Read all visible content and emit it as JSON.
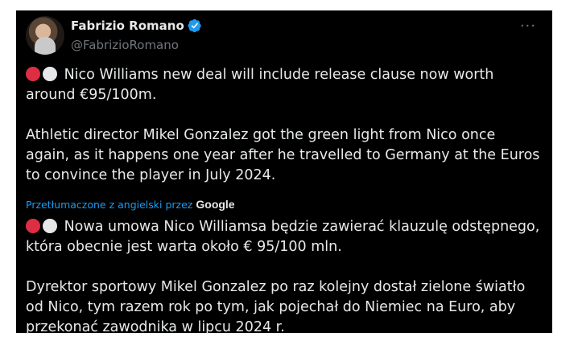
{
  "author": {
    "display_name": "Fabrizio Romano",
    "handle": "@FabrizioRomano",
    "verified_icon": "verified-badge-icon",
    "more_label": "···"
  },
  "tweet": {
    "paragraphs": [
      "Nico Williams new deal will include release clause now worth around €95/100m.",
      "Athletic director Mikel Gonzalez got the green light from Nico once again, as it happens one year after he travelled to Germany at the Euros to convince the player in July 2024."
    ]
  },
  "translation": {
    "label": "Przetłumaczone z angielski przez",
    "provider": "Google",
    "paragraphs": [
      "Nowa umowa Nico Williamsa będzie zawierać klauzulę odstępnego, która obecnie jest warta około € 95/100 mln.",
      "Dyrektor sportowy Mikel Gonzalez po raz kolejny dostał zielone światło od Nico, tym razem rok po tym, jak pojechał do Niemiec na Euro, aby przekonać zawodnika w lipcu 2024 r."
    ]
  },
  "colors": {
    "background": "#000000",
    "text": "#e7e9ea",
    "muted": "#71767b",
    "link": "#1d9bf0",
    "verified": "#1d9bf0",
    "emoji_red": "#dd2e44",
    "emoji_white": "#e6e7e8"
  }
}
